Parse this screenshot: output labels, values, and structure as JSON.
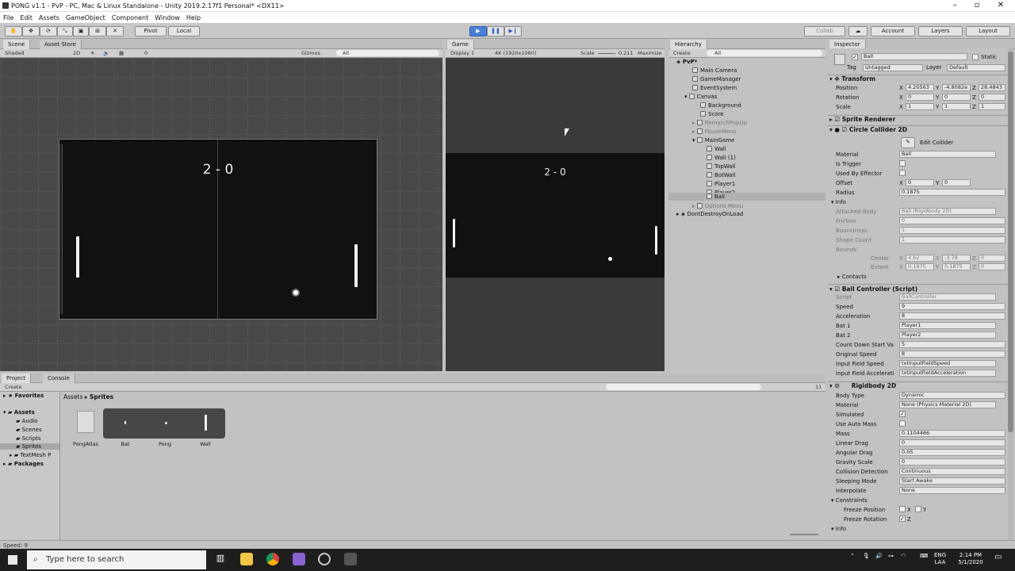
{
  "window": {
    "title": "PONG v1.1 - PvP - PC, Mac & Linux Standalone - Unity 2019.2.17f1 Personal* <DX11>"
  },
  "menu": [
    "File",
    "Edit",
    "Assets",
    "GameObject",
    "Component",
    "Window",
    "Help"
  ],
  "toolbar": {
    "pivot": "Pivot",
    "local": "Local",
    "collab": "Collab",
    "account": "Account",
    "layers": "Layers",
    "layout": "Layout"
  },
  "scene": {
    "tab": "Scene",
    "tab2": "Asset Store",
    "shading": "Shaded",
    "mode2d": "2D",
    "gizmos": "Gizmos",
    "search": "All",
    "layercount": "0",
    "score": "2 - 0"
  },
  "game": {
    "tab": "Game",
    "display": "Display 1",
    "resolution": "4K (1920x1080)",
    "scale_label": "Scale",
    "scale_value": "0.211",
    "maximize": "Maximize",
    "score": "2 - 0"
  },
  "hierarchy": {
    "tab": "Hierarchy",
    "create": "Create",
    "search": "All",
    "items": [
      "PvP*",
      "Main Camera",
      "GameManager",
      "EventSystem",
      "Canvas",
      "Background",
      "Score",
      "RematchPopUp",
      "PauseMenu",
      "MainGame",
      "Wall",
      "Wall (1)",
      "TopWall",
      "BotWall",
      "Player1",
      "Player2",
      "Ball",
      "Options Menu",
      "DontDestroyOnLoad"
    ]
  },
  "inspector": {
    "tab": "Inspector",
    "name": "Ball",
    "static": "Static",
    "tag_label": "Tag",
    "tag": "Untagged",
    "layer_label": "Layer",
    "layer": "Default",
    "transform": {
      "title": "Transform",
      "position": "Position",
      "rotation": "Rotation",
      "scale": "Scale",
      "px": "4.20563",
      "py": "-4.8082e",
      "pz": "28.4843",
      "rx": "0",
      "ry": "0",
      "rz": "0",
      "sx": "1",
      "sy": "1",
      "sz": "1"
    },
    "sprite": "Sprite Renderer",
    "collider": {
      "title": "Circle Collider 2D",
      "edit": "Edit Collider",
      "material_label": "Material",
      "material": "Ball",
      "trigger": "Is Trigger",
      "effector": "Used By Effector",
      "offset": "Offset",
      "ox": "0",
      "oy": "0",
      "radius_label": "Radius",
      "radius": "0.1875",
      "info": "Info",
      "attached_label": "Attached Body",
      "attached": "Ball (Rigidbody 2D)",
      "friction": "Friction",
      "friction_v": "0",
      "bounciness": "Bounciness",
      "bounciness_v": "1",
      "shape": "Shape Count",
      "shape_v": "1",
      "bounds": "Bounds",
      "center": "Center",
      "cx": "4.62",
      "cy": "-3.78",
      "cz": "0",
      "extent": "Extent",
      "ex": "0.1875",
      "ey": "0.1875",
      "ez": "0",
      "contacts": "Contacts"
    },
    "script": {
      "title": "Ball Controller (Script)",
      "script_label": "Script",
      "script": "BallController",
      "speed": "Speed",
      "speed_v": "9",
      "accel": "Acceleration",
      "accel_v": "8",
      "bat1": "Bat 1",
      "bat1_v": "Player1",
      "bat2": "Bat 2",
      "bat2_v": "Player2",
      "countdown": "Count Down Start Va",
      "countdown_v": "5",
      "orig": "Original Speed",
      "orig_v": "8",
      "ifs": "Input Field Speed",
      "ifs_v": "txtInputFieldSpeed",
      "ifa": "Input Field Accelerati",
      "ifa_v": "txtInputFieldAcceleration"
    },
    "rb": {
      "title": "Rigidbody 2D",
      "bodytype": "Body Type",
      "bodytype_v": "Dynamic",
      "material": "Material",
      "material_v": "None (Physics Material 2D)",
      "simulated": "Simulated",
      "automass": "Use Auto Mass",
      "mass": "Mass",
      "mass_v": "0.1104466",
      "ldrag": "Linear Drag",
      "ldrag_v": "0",
      "adrag": "Angular Drag",
      "adrag_v": "0.05",
      "gravity": "Gravity Scale",
      "gravity_v": "0",
      "collision": "Collision Detection",
      "collision_v": "Continuous",
      "sleeping": "Sleeping Mode",
      "sleeping_v": "Start Awake",
      "interp": "Interpolate",
      "interp_v": "None",
      "constraints": "Constraints",
      "fpos": "Freeze Position",
      "frot": "Freeze Rotation",
      "x": "X",
      "y": "Y",
      "z": "Z",
      "info": "Info"
    }
  },
  "project": {
    "tab": "Project",
    "tab2": "Console",
    "create": "Create",
    "breadcrumb1": "Assets",
    "breadcrumb2": "Sprites",
    "count": "11",
    "tree": [
      "Favorites",
      "Assets",
      "Audio",
      "Scenes",
      "Scripts",
      "Sprites",
      "TextMesh P",
      "Packages"
    ],
    "assets": [
      "PongAtlas",
      "Bat",
      "Pong",
      "Wall"
    ]
  },
  "status": "Speed: 9",
  "taskbar": {
    "search": "Type here to search",
    "lang1": "ENG",
    "lang2": "LAA",
    "time": "2:14 PM",
    "date": "5/1/2020"
  }
}
